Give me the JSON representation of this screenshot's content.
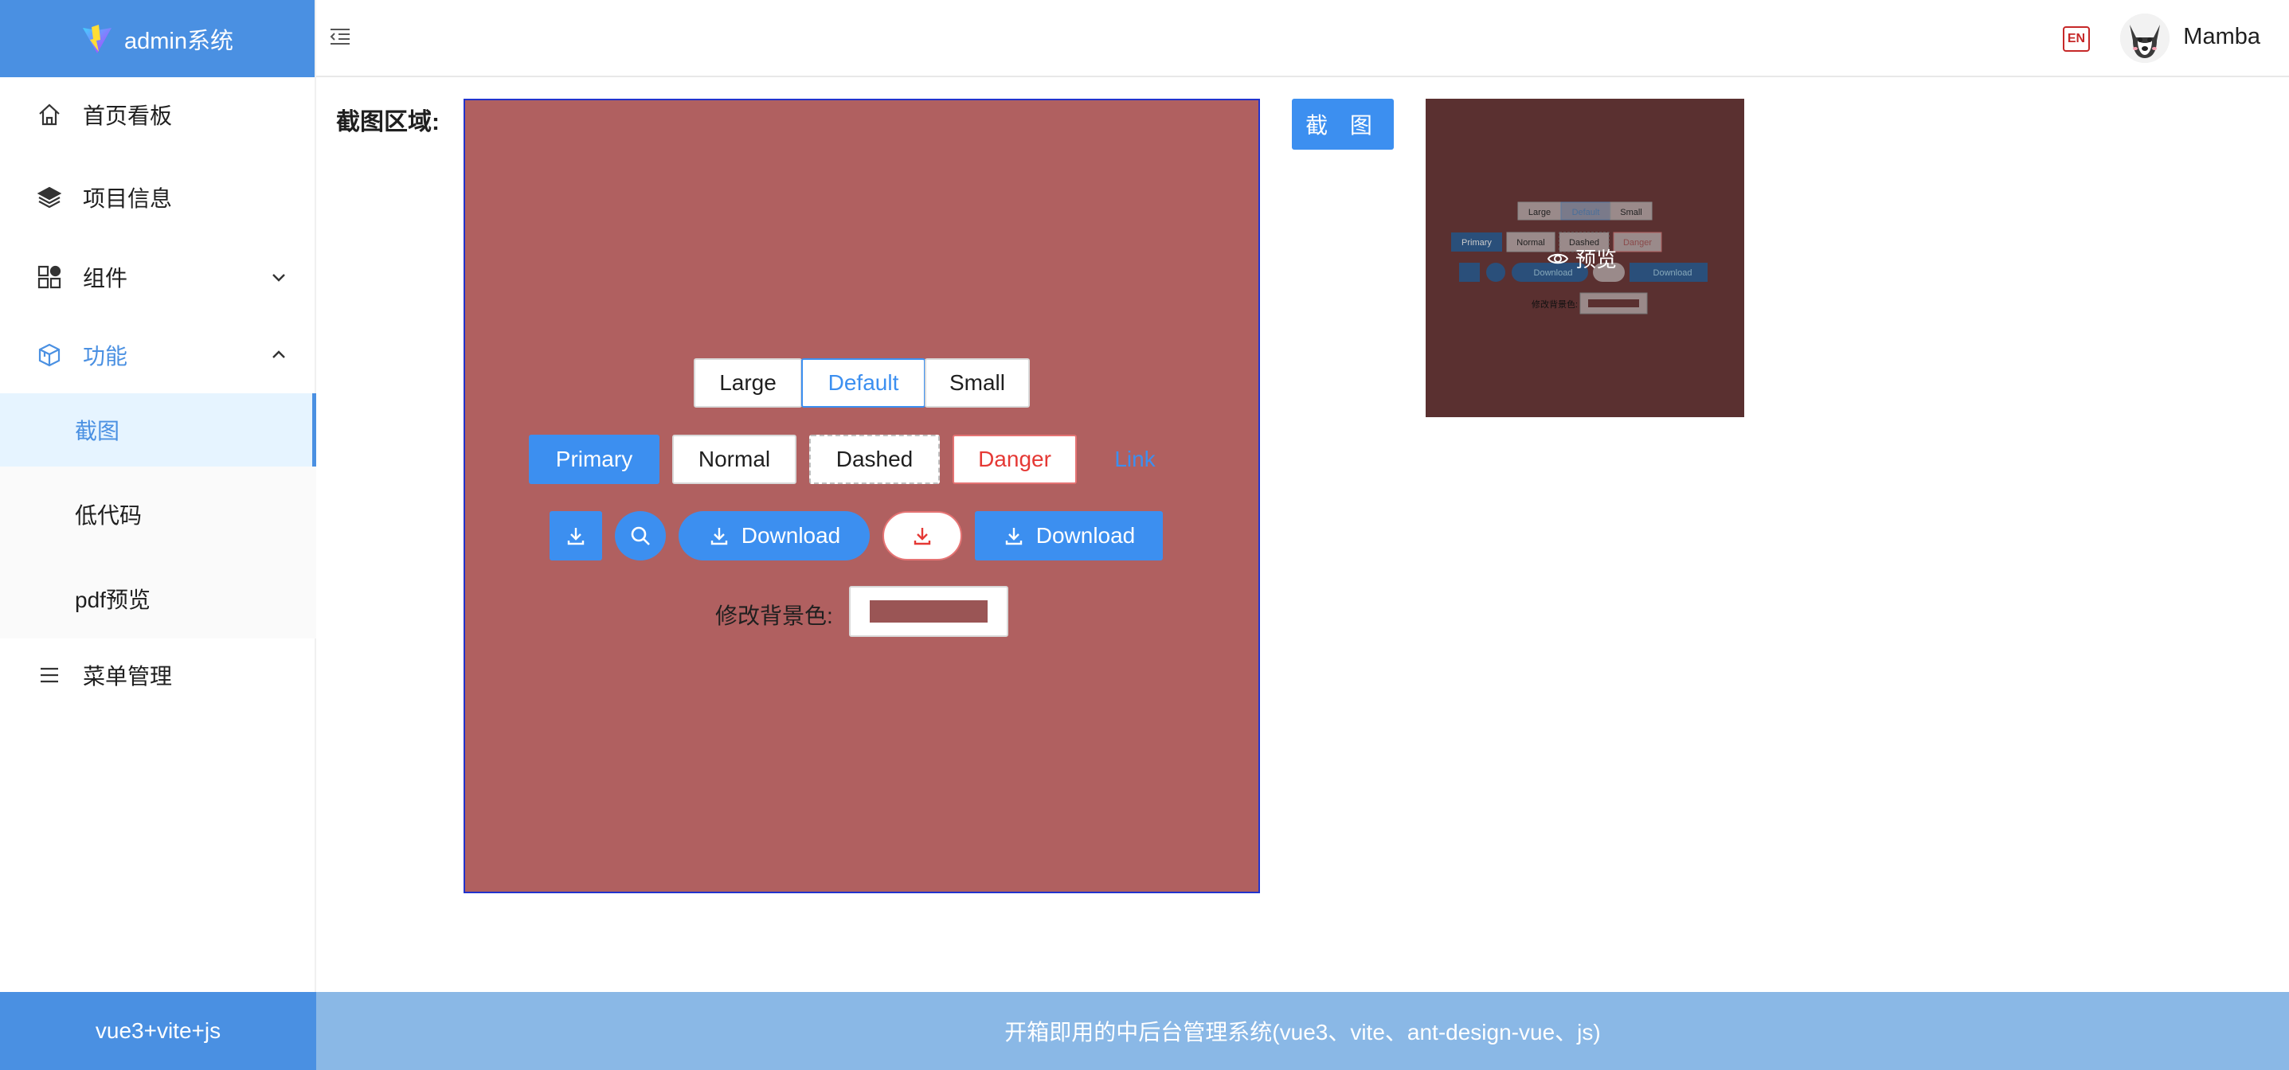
{
  "app": {
    "title": "admin系统"
  },
  "sidebar": {
    "items": [
      {
        "label": "首页看板",
        "icon": "home-icon"
      },
      {
        "label": "项目信息",
        "icon": "layers-icon"
      },
      {
        "label": "组件",
        "icon": "apps-icon"
      },
      {
        "label": "功能",
        "icon": "cube-icon"
      },
      {
        "label": "菜单管理",
        "icon": "menu-icon"
      }
    ],
    "sub_items": [
      {
        "label": "截图"
      },
      {
        "label": "低代码"
      },
      {
        "label": "pdf预览"
      }
    ]
  },
  "header": {
    "lang_badge": "EN",
    "username": "Mamba"
  },
  "main": {
    "area_label": "截图区域:",
    "size_buttons": [
      "Large",
      "Default",
      "Small"
    ],
    "type_buttons": [
      "Primary",
      "Normal",
      "Dashed",
      "Danger",
      "Link"
    ],
    "download_label": "Download",
    "color_label": "修改背景色:",
    "screenshot_button": "截 图",
    "preview_label": "预览"
  },
  "mini": {
    "size_buttons": [
      "Large",
      "Default",
      "Small"
    ],
    "type_buttons": [
      "Primary",
      "Normal",
      "Dashed",
      "Danger"
    ],
    "download_label": "Download",
    "color_label": "修改背景色:"
  },
  "footer": {
    "left": "vue3+vite+js",
    "right": "开箱即用的中后台管理系统(vue3、vite、ant-design-vue、js)"
  },
  "colors": {
    "accent": "#3c8ff0",
    "capture_bg": "#b06060",
    "danger": "#e53935"
  }
}
